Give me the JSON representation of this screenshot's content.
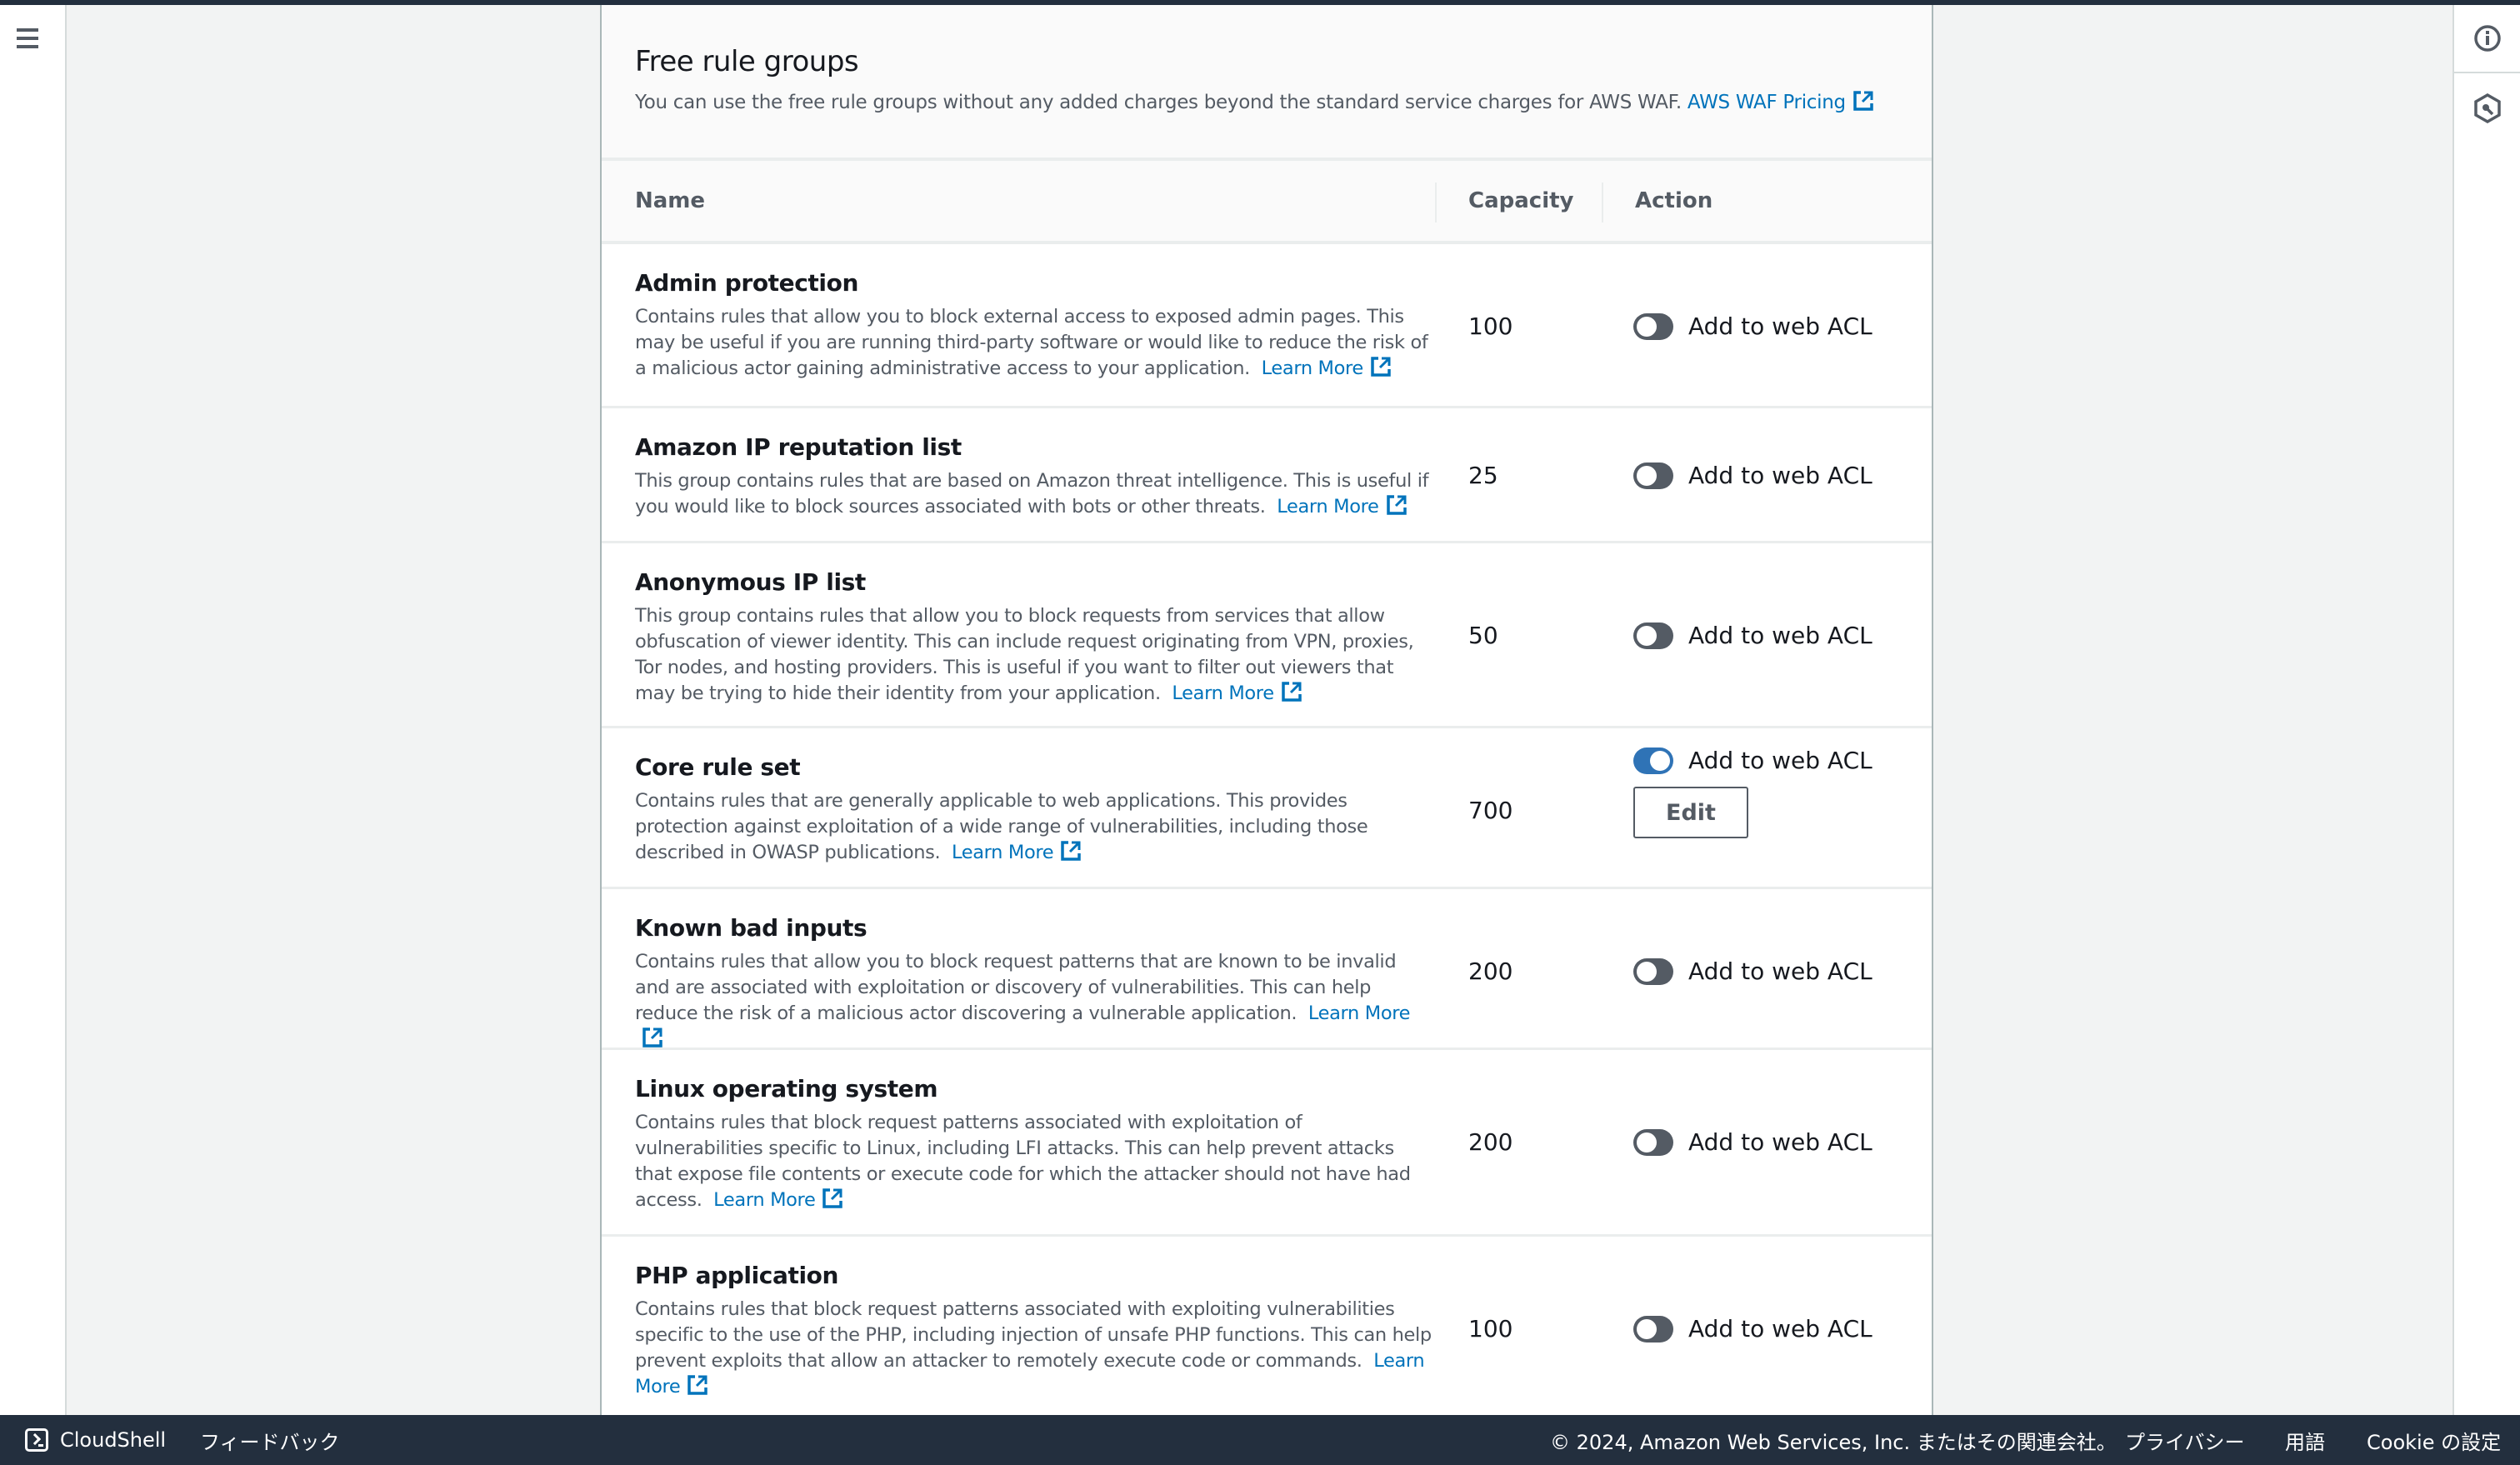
{
  "nav": {
    "menu_icon": "hamburger-menu-icon"
  },
  "right_rail": {
    "info_icon": "info-icon",
    "second_icon": "hexagon-search-icon"
  },
  "card": {
    "title": "Free rule groups",
    "description": "You can use the free rule groups without any added charges beyond the standard service charges for AWS WAF.",
    "pricing_link": "AWS WAF Pricing"
  },
  "table": {
    "columns": {
      "name": "Name",
      "capacity": "Capacity",
      "action": "Action"
    },
    "learn_more": "Learn More",
    "toggle_label": "Add to web ACL",
    "edit_label": "Edit",
    "rows": [
      {
        "name": "Admin protection",
        "description": "Contains rules that allow you to block external access to exposed admin pages. This may be useful if you are running third-party software or would like to reduce the risk of a malicious actor gaining administrative access to your application.",
        "capacity": "100",
        "enabled": false
      },
      {
        "name": "Amazon IP reputation list",
        "description": "This group contains rules that are based on Amazon threat intelligence. This is useful if you would like to block sources associated with bots or other threats.",
        "capacity": "25",
        "enabled": false
      },
      {
        "name": "Anonymous IP list",
        "description": "This group contains rules that allow you to block requests from services that allow obfuscation of viewer identity. This can include request originating from VPN, proxies, Tor nodes, and hosting providers. This is useful if you want to filter out viewers that may be trying to hide their identity from your application.",
        "capacity": "50",
        "enabled": false
      },
      {
        "name": "Core rule set",
        "description": "Contains rules that are generally applicable to web applications. This provides protection against exploitation of a wide range of vulnerabilities, including those described in OWASP publications.",
        "capacity": "700",
        "enabled": true
      },
      {
        "name": "Known bad inputs",
        "description": "Contains rules that allow you to block request patterns that are known to be invalid and are associated with exploitation or discovery of vulnerabilities. This can help reduce the risk of a malicious actor discovering a vulnerable application.",
        "capacity": "200",
        "enabled": false
      },
      {
        "name": "Linux operating system",
        "description": "Contains rules that block request patterns associated with exploitation of vulnerabilities specific to Linux, including LFI attacks. This can help prevent attacks that expose file contents or execute code for which the attacker should not have had access.",
        "capacity": "200",
        "enabled": false
      },
      {
        "name": "PHP application",
        "description": "Contains rules that block request patterns associated with exploiting vulnerabilities specific to the use of the PHP, including injection of unsafe PHP functions. This can help prevent exploits that allow an attacker to remotely execute code or commands.",
        "capacity": "100",
        "enabled": false
      }
    ]
  },
  "footer": {
    "cloudshell": "CloudShell",
    "feedback": "フィードバック",
    "copyright": "© 2024, Amazon Web Services, Inc. またはその関連会社。",
    "privacy": "プライバシー",
    "terms": "用語",
    "cookie": "Cookie の設定"
  },
  "colors": {
    "link": "#0073bb",
    "toggle_on": "#2f73b6",
    "toggle_off": "#545b64",
    "footer_bg": "#232f3e"
  }
}
